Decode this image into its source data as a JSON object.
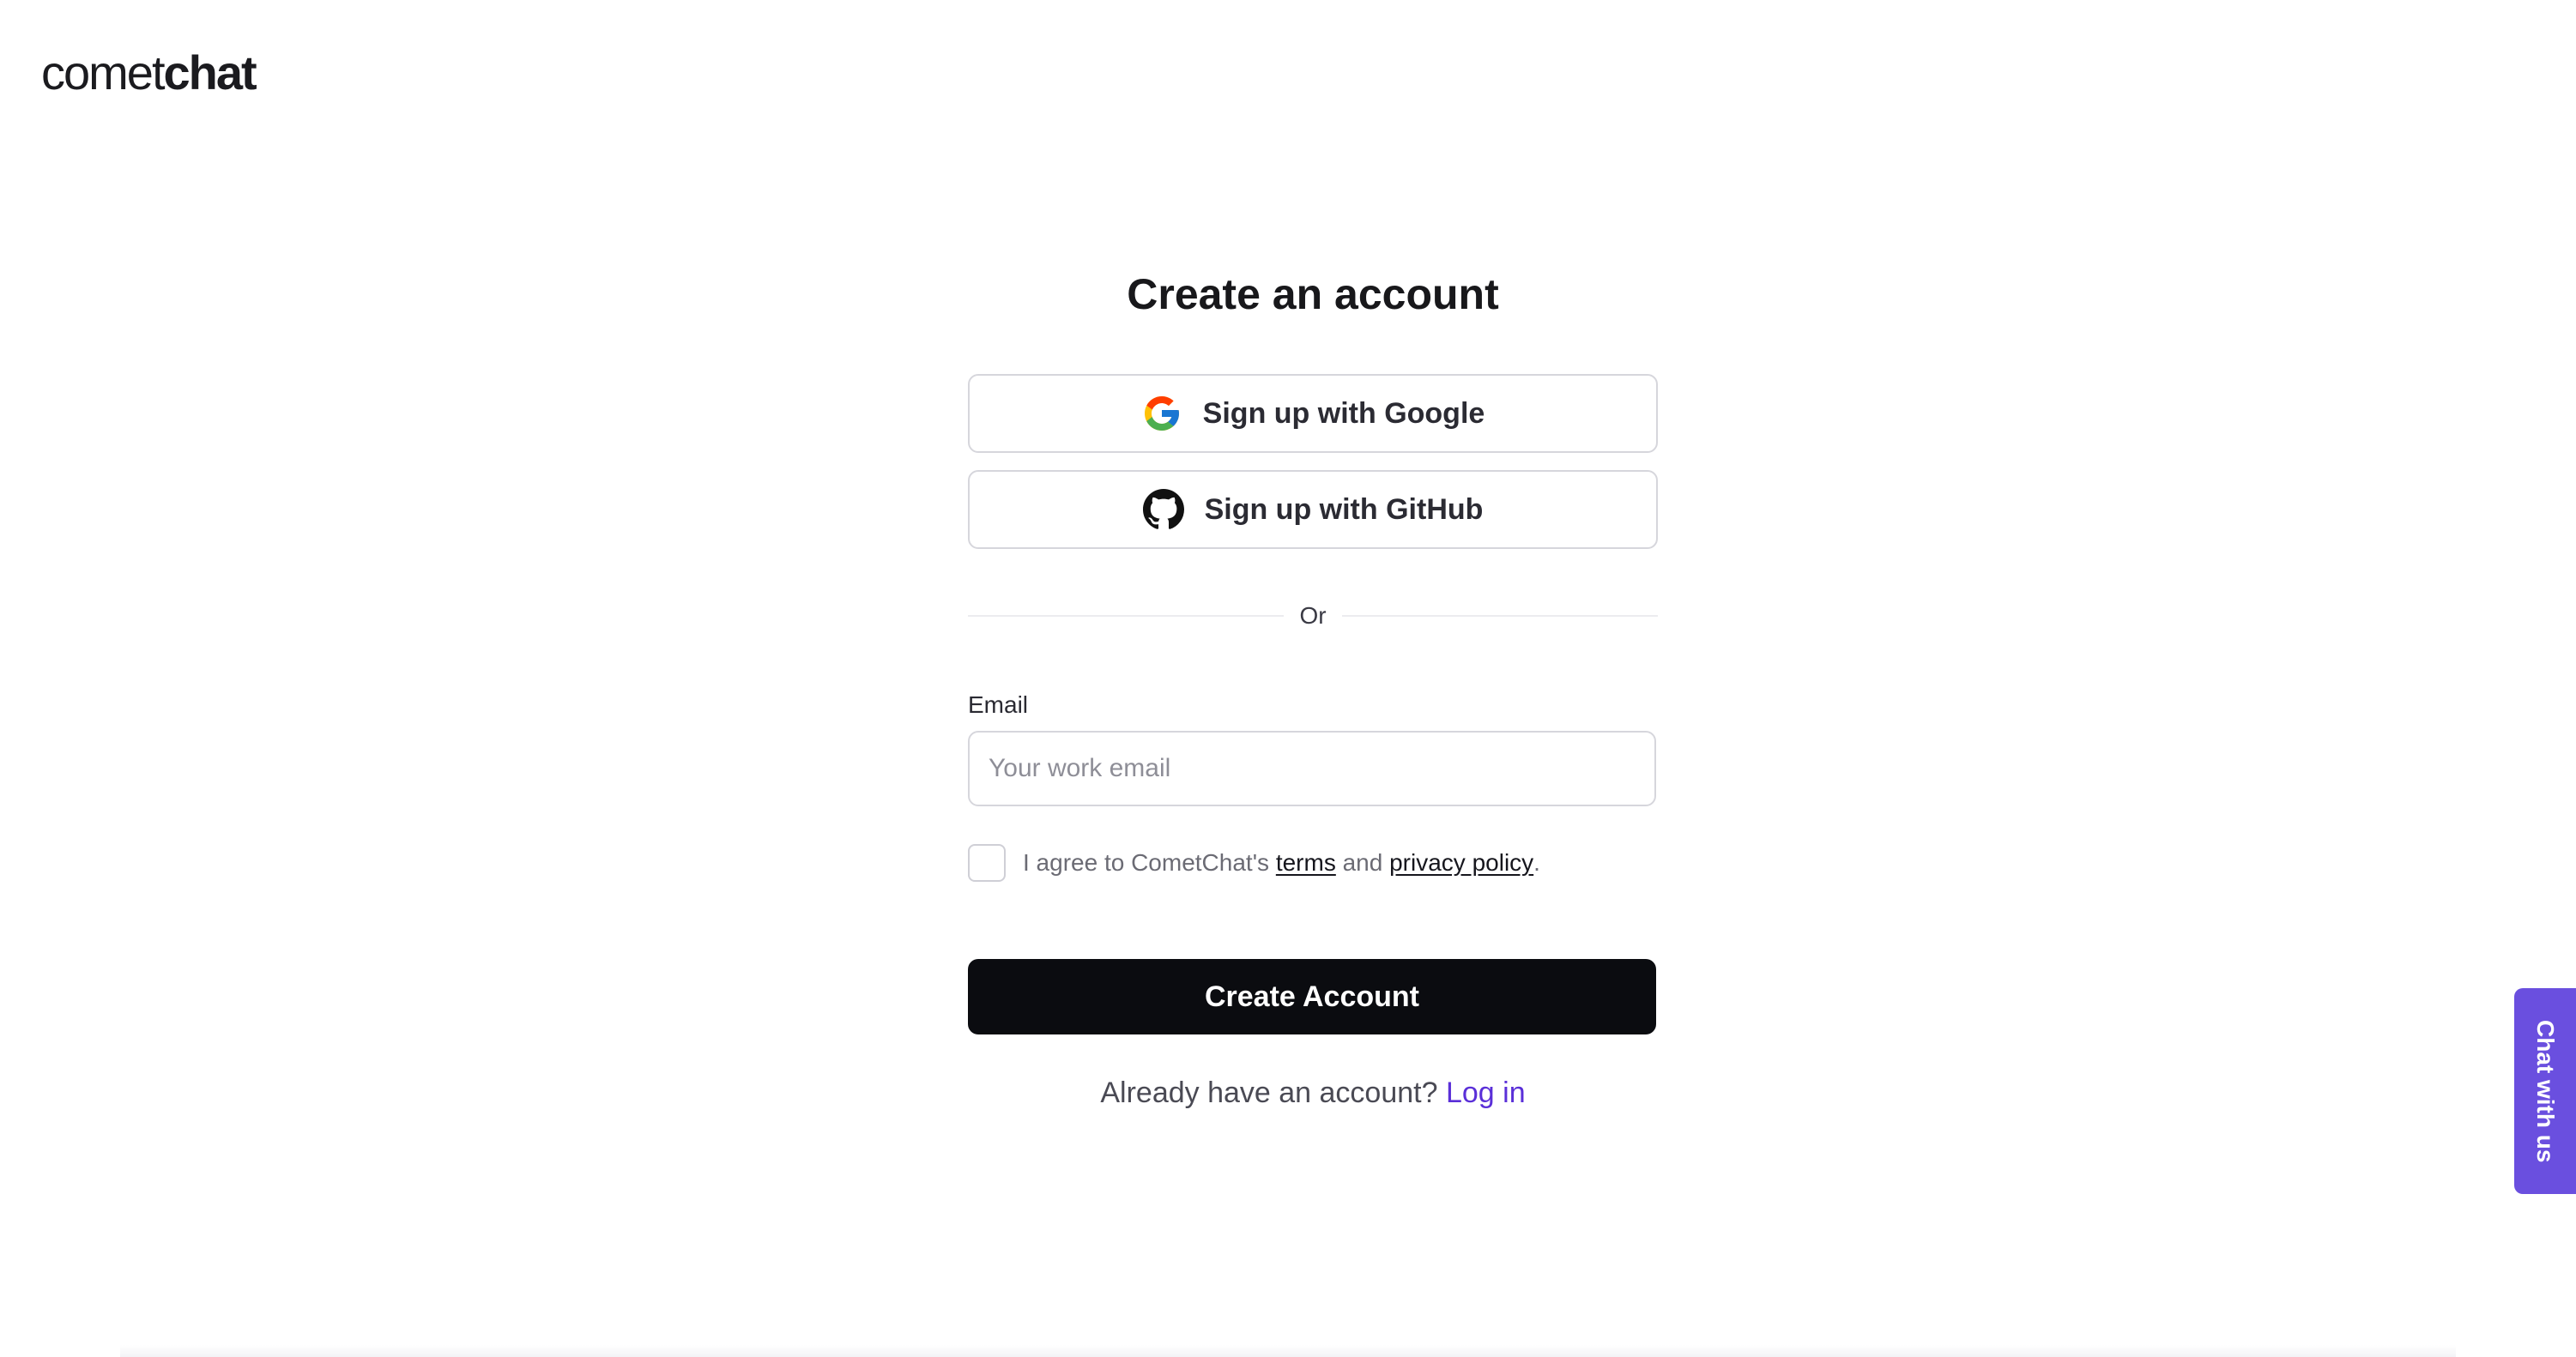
{
  "header": {
    "logo_light": "comet",
    "logo_bold": "chat"
  },
  "form": {
    "title": "Create an account",
    "google_label": "Sign up with Google",
    "github_label": "Sign up with GitHub",
    "divider_text": "Or",
    "email_label": "Email",
    "email_placeholder": "Your work email",
    "email_value": "",
    "agree_prefix": "I agree to CometChat's",
    "agree_terms": "terms",
    "agree_and": "and",
    "agree_privacy": "privacy policy",
    "agree_suffix": ".",
    "agree_checked": false,
    "create_label": "Create Account",
    "login_prompt": "Already have an account?",
    "login_link": "Log in"
  },
  "chat_widget": {
    "label": "Chat with us"
  },
  "colors": {
    "primary_button": "#0b0c10",
    "link": "#5a2fd8",
    "chat_tab": "#6a4fdf"
  },
  "icons": {
    "google": "google-icon",
    "github": "github-icon"
  }
}
